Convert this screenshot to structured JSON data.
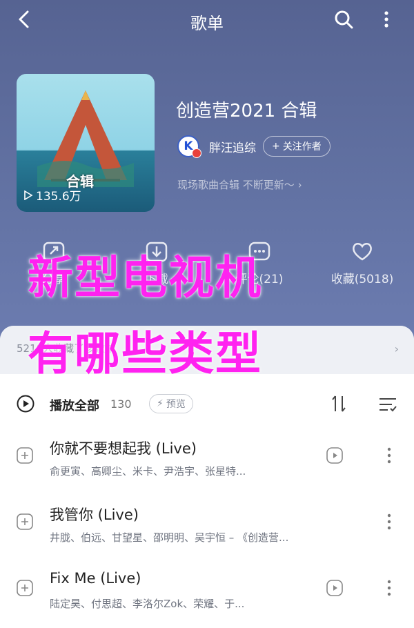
{
  "header": {
    "title": "歌单"
  },
  "album": {
    "cover_play_count": "135.6万",
    "cover_text": "合辑",
    "title": "创造营2021 合辑",
    "author": {
      "avatar_letter": "K",
      "name": "胖汪追综",
      "follow_label": "关注作者"
    },
    "description": "现场歌曲合辑 不断更新～"
  },
  "actions": [
    {
      "label": "分享",
      "icon": "share-icon"
    },
    {
      "label": "下载",
      "icon": "download-icon"
    },
    {
      "label": "评论(21)",
      "icon": "comment-icon"
    },
    {
      "label": "收藏(5018)",
      "icon": "favorite-icon"
    }
  ],
  "collect_bar": {
    "text": "5218人收藏了该歌单"
  },
  "playlist": {
    "play_all_label": "播放全部",
    "count": "130",
    "preview_label": "预览",
    "songs": [
      {
        "title": "你就不要想起我 (Live)",
        "artists": "俞更寅、高卿尘、米卡、尹浩宇、张星特..."
      },
      {
        "title": "我管你 (Live)",
        "artists": "井胧、伯远、甘望星、邵明明、吴宇恒 – 《创造营..."
      },
      {
        "title": "Fix Me (Live)",
        "artists": "陆定昊、付思超、李洛尔Zok、荣耀、于..."
      }
    ]
  },
  "overlay": {
    "line1": "新型电视机",
    "line2": "有哪些类型"
  },
  "colors": {
    "overlay_text": "#ff22f0",
    "header_bg": "#5c6b9a"
  }
}
